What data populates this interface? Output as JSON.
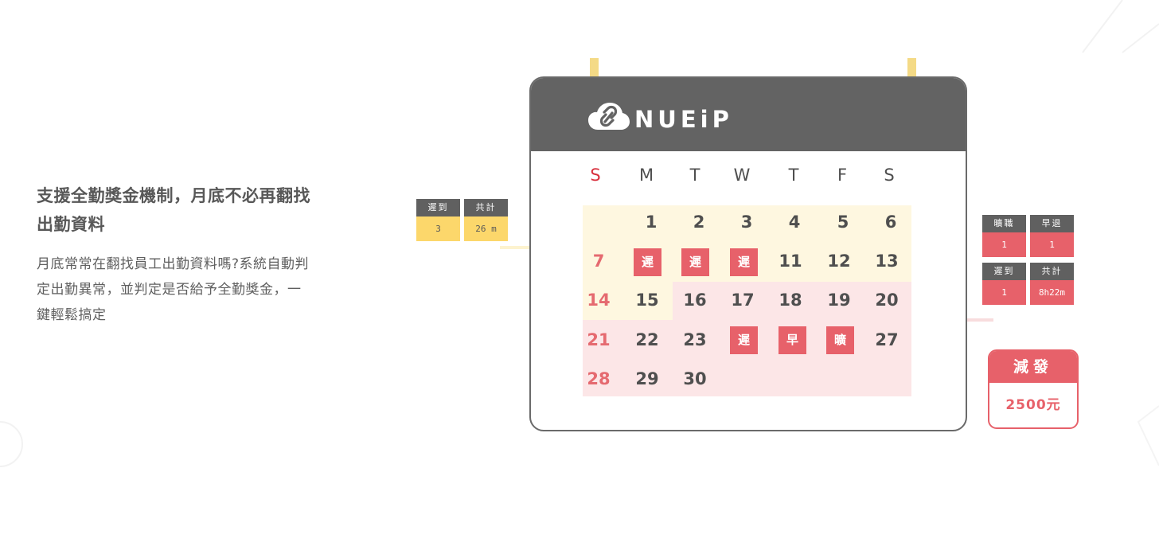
{
  "section": {
    "heading_line1": "支援全勤獎金機制，月底不必再翻找",
    "heading_line2": "出勤資料",
    "desc_line1": "月底常常在翻找員工出勤資料嗎?系統自動判",
    "desc_line2": "定出勤異常，並判定是否給予全勤獎金，一",
    "desc_line3": "鍵輕鬆搞定"
  },
  "left_tags": [
    {
      "label": "遲到",
      "value": "3"
    },
    {
      "label": "共計",
      "value": "26 m"
    }
  ],
  "right_tags_top": [
    {
      "label": "曠職",
      "value": "1"
    },
    {
      "label": "早退",
      "value": "1"
    }
  ],
  "right_tags_bottom": [
    {
      "label": "遲到",
      "value": "1"
    },
    {
      "label": "共計",
      "value": "8h22m"
    }
  ],
  "calendar": {
    "logo_icon": "cloud-link-logo-icon",
    "brand": "NUEiP",
    "weekdays": [
      "S",
      "M",
      "T",
      "W",
      "T",
      "F",
      "S"
    ],
    "days": [
      "1",
      "2",
      "3",
      "4",
      "5",
      "6",
      "7",
      "14",
      "15",
      "16",
      "17",
      "18",
      "19",
      "20",
      "21",
      "22",
      "23",
      "27",
      "28",
      "29",
      "30",
      "11",
      "12",
      "13"
    ],
    "marks": [
      "遲",
      "遲",
      "遲",
      "遲",
      "早",
      "曠"
    ]
  },
  "deduction": {
    "label": "減發",
    "amount": "2500元"
  },
  "colors": {
    "accent_red": "#e7616a",
    "yellow_tag": "#fcd76b",
    "header_gray": "#636363",
    "yellow_area": "#fef7e0",
    "pink_area": "#fce6e7",
    "sunday_red": "#d8313e"
  }
}
